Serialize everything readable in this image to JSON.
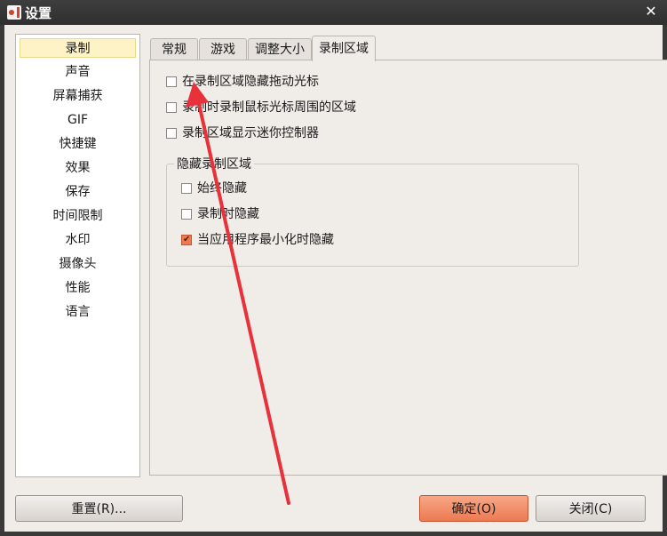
{
  "window": {
    "title": "设置",
    "close_glyph": "✕"
  },
  "sidebar": {
    "items": [
      {
        "label": "录制",
        "selected": true
      },
      {
        "label": "声音"
      },
      {
        "label": "屏幕捕获"
      },
      {
        "label": "GIF"
      },
      {
        "label": "快捷键"
      },
      {
        "label": "效果"
      },
      {
        "label": "保存"
      },
      {
        "label": "时间限制"
      },
      {
        "label": "水印"
      },
      {
        "label": "摄像头"
      },
      {
        "label": "性能"
      },
      {
        "label": "语言"
      }
    ]
  },
  "tabs": [
    {
      "label": "常规"
    },
    {
      "label": "游戏"
    },
    {
      "label": "调整大小"
    },
    {
      "label": "录制区域",
      "active": true
    }
  ],
  "panel": {
    "options": [
      {
        "label": "在录制区域隐藏拖动光标",
        "checked": false
      },
      {
        "label": "录制时录制鼠标光标周围的区域",
        "checked": false
      },
      {
        "label": "录制区域显示迷你控制器",
        "checked": false
      }
    ],
    "group": {
      "title": "隐藏录制区域",
      "options": [
        {
          "label": "始终隐藏",
          "checked": false
        },
        {
          "label": "录制时隐藏",
          "checked": false
        },
        {
          "label": "当应用程序最小化时隐藏",
          "checked": true
        }
      ]
    }
  },
  "buttons": {
    "reset": "重置(R)...",
    "ok": "确定(O)",
    "close": "关闭(C)"
  },
  "colors": {
    "accent": "#ec7a52",
    "annotation": "#e8313a"
  },
  "icons": {
    "app": "app-icon",
    "close": "close-icon",
    "checkmark": "checkmark-icon",
    "annotation": "red-arrow"
  }
}
